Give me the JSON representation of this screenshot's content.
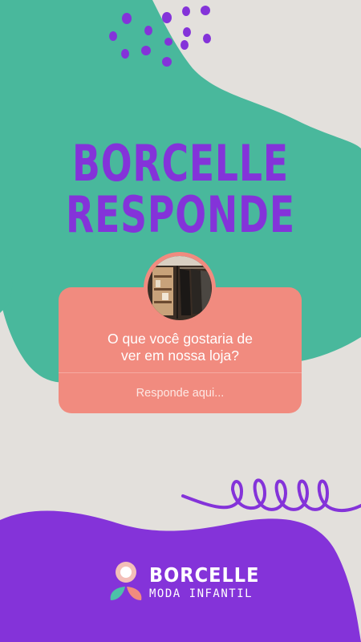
{
  "colors": {
    "background": "#e3e0dc",
    "teal": "#49b89c",
    "purple": "#8433d9",
    "coral": "#f18b7f",
    "white": "#ffffff"
  },
  "headline": {
    "line1": "BORCELLE",
    "line2": "RESPONDE"
  },
  "question_card": {
    "question": "O que você gostaria de ver em nossa loja?",
    "answer_placeholder": "Responde aqui..."
  },
  "logo": {
    "brand": "BORCELLE",
    "subtitle": "MODA INFANTIL"
  }
}
